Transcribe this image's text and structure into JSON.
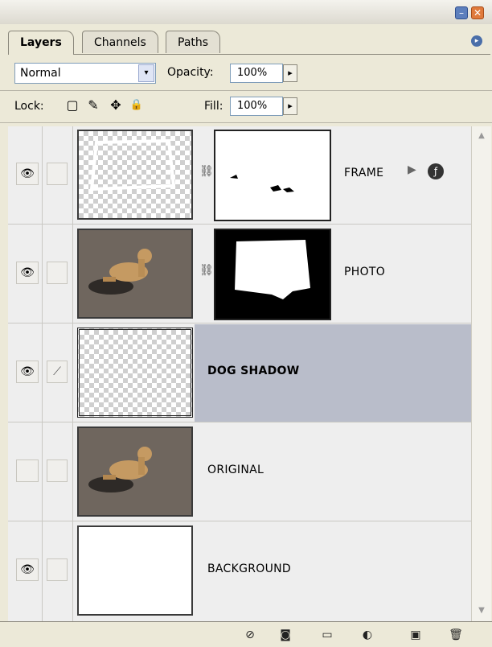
{
  "panel": {
    "tabs": [
      {
        "label": "Layers",
        "active": true
      },
      {
        "label": "Channels",
        "active": false
      },
      {
        "label": "Paths",
        "active": false
      }
    ],
    "blend_mode": "Normal",
    "opacity_label": "Opacity:",
    "opacity_value": "100%",
    "lock_label": "Lock:",
    "fill_label": "Fill:",
    "fill_value": "100%"
  },
  "layers": [
    {
      "name": "FRAME",
      "visible": true,
      "selected": false,
      "thumbnail": "transparent-frame",
      "has_mask": true,
      "has_effects": true
    },
    {
      "name": "PHOTO",
      "visible": true,
      "selected": false,
      "thumbnail": "dog-photo",
      "has_mask": true,
      "has_effects": false
    },
    {
      "name": "DOG SHADOW",
      "visible": true,
      "selected": true,
      "thumbnail": "transparent",
      "has_mask": false,
      "has_effects": false
    },
    {
      "name": "ORIGINAL",
      "visible": false,
      "selected": false,
      "thumbnail": "dog-photo",
      "has_mask": false,
      "has_effects": false
    },
    {
      "name": "BACKGROUND",
      "visible": true,
      "selected": false,
      "thumbnail": "white",
      "has_mask": false,
      "has_effects": false
    }
  ],
  "icons": {
    "visibility": "eye-icon",
    "paint": "brush-icon",
    "link": "chain-link-icon",
    "effects": "fx-icon",
    "footer": [
      "link-layers-icon",
      "add-mask-icon",
      "new-group-icon",
      "adjustment-layer-icon",
      "new-layer-icon",
      "trash-icon"
    ]
  },
  "glyphs": {
    "dropdown": "▾",
    "arrow": "▸",
    "minimize": "–",
    "close": "✕",
    "flyout": "▸",
    "eye": "👁",
    "brush": "⟋",
    "chain": "⛓",
    "fx_arrow": "▶",
    "fx": "ƒ",
    "scroll_up": "▲",
    "scroll_down": "▼",
    "lock_transparent": "▢",
    "lock_image": "✎",
    "lock_position": "✥",
    "lock_all": "🔒",
    "footer": [
      "⊘",
      "◙",
      "▭",
      "◐",
      "▣",
      "🗑"
    ]
  }
}
